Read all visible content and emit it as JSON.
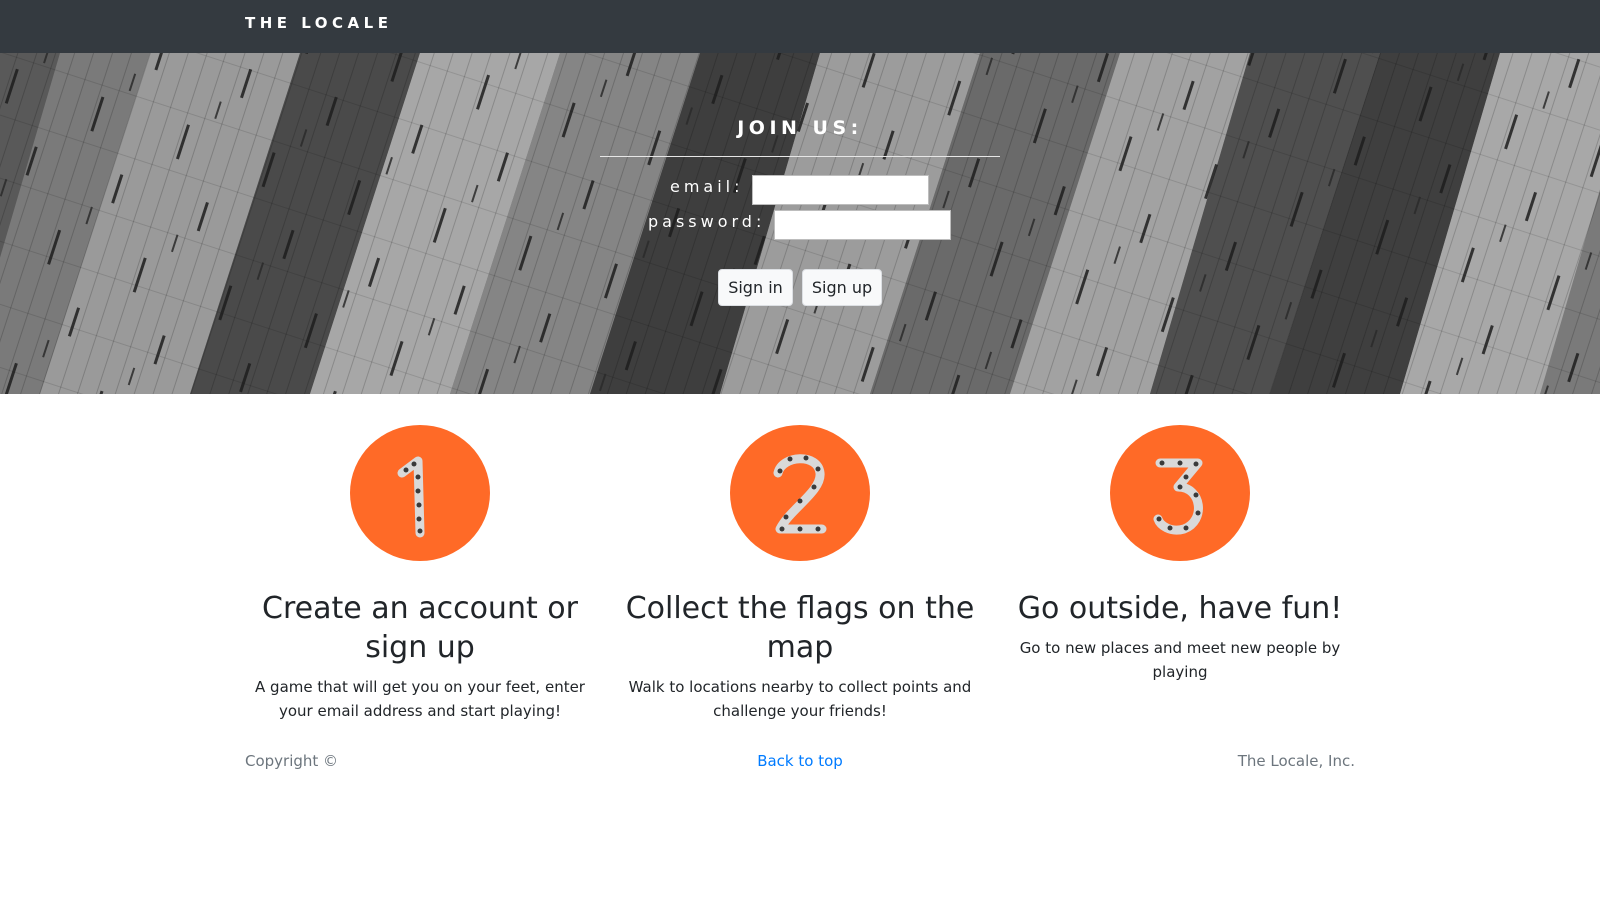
{
  "navbar": {
    "brand": "THE LOCALE",
    "background": "#343a40"
  },
  "signup": {
    "title": "JOIN US:",
    "email_label": "email:",
    "email_value": "",
    "password_label": "password:",
    "password_value": "",
    "signin_label": "Sign in",
    "signup_label": "Sign up"
  },
  "steps": [
    {
      "number": "1",
      "title": "Create an account or sign up",
      "text": "A game that will get you on your feet, enter your email address and start playing!"
    },
    {
      "number": "2",
      "title": "Collect the flags on the map",
      "text": "Walk to locations nearby to collect points and challenge your friends!"
    },
    {
      "number": "3",
      "title": "Go outside, have fun!",
      "text": "Go to new places and meet new people by playing"
    }
  ],
  "footer": {
    "copyright": "Copyright ©",
    "back_to_top": "Back to top",
    "company": "The Locale, Inc."
  },
  "colors": {
    "accent": "#ff6a27",
    "link": "#007bff",
    "muted": "#6c757d"
  }
}
